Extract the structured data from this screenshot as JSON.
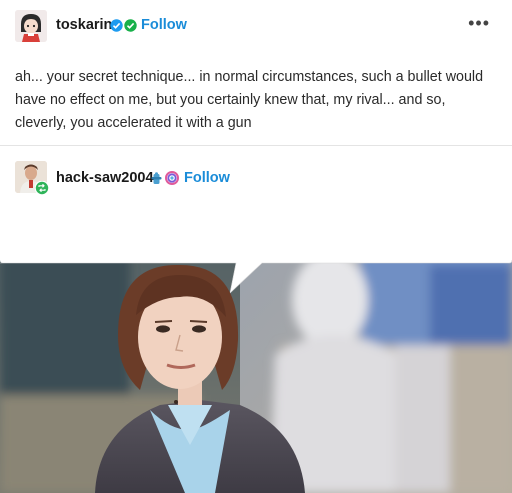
{
  "post": {
    "author": "toskarin",
    "follow_label": "Follow",
    "more_label": "•••",
    "body_text": "ah... your secret technique... in normal circumstances, such a bullet would have no effect on me, but you certainly knew that, my rival... and so, cleverly, you accelerated it with a gun"
  },
  "reblog": {
    "author": "hack-saw2004",
    "follow_label": "Follow"
  },
  "colors": {
    "follow_blue": "#1a8cd8",
    "verified_blue": "#1d9bf0",
    "verified_green": "#18b04a",
    "reblog_green": "#2fb45a"
  },
  "icons": {
    "more": "ellipsis-icon",
    "badge1": "verified-blue-badge-icon",
    "badge2": "verified-green-badge-icon",
    "reblog_badge": "reblog-badge-icon",
    "badge3": "fire-hydrant-badge-icon",
    "badge4": "rainbow-circle-badge-icon"
  }
}
